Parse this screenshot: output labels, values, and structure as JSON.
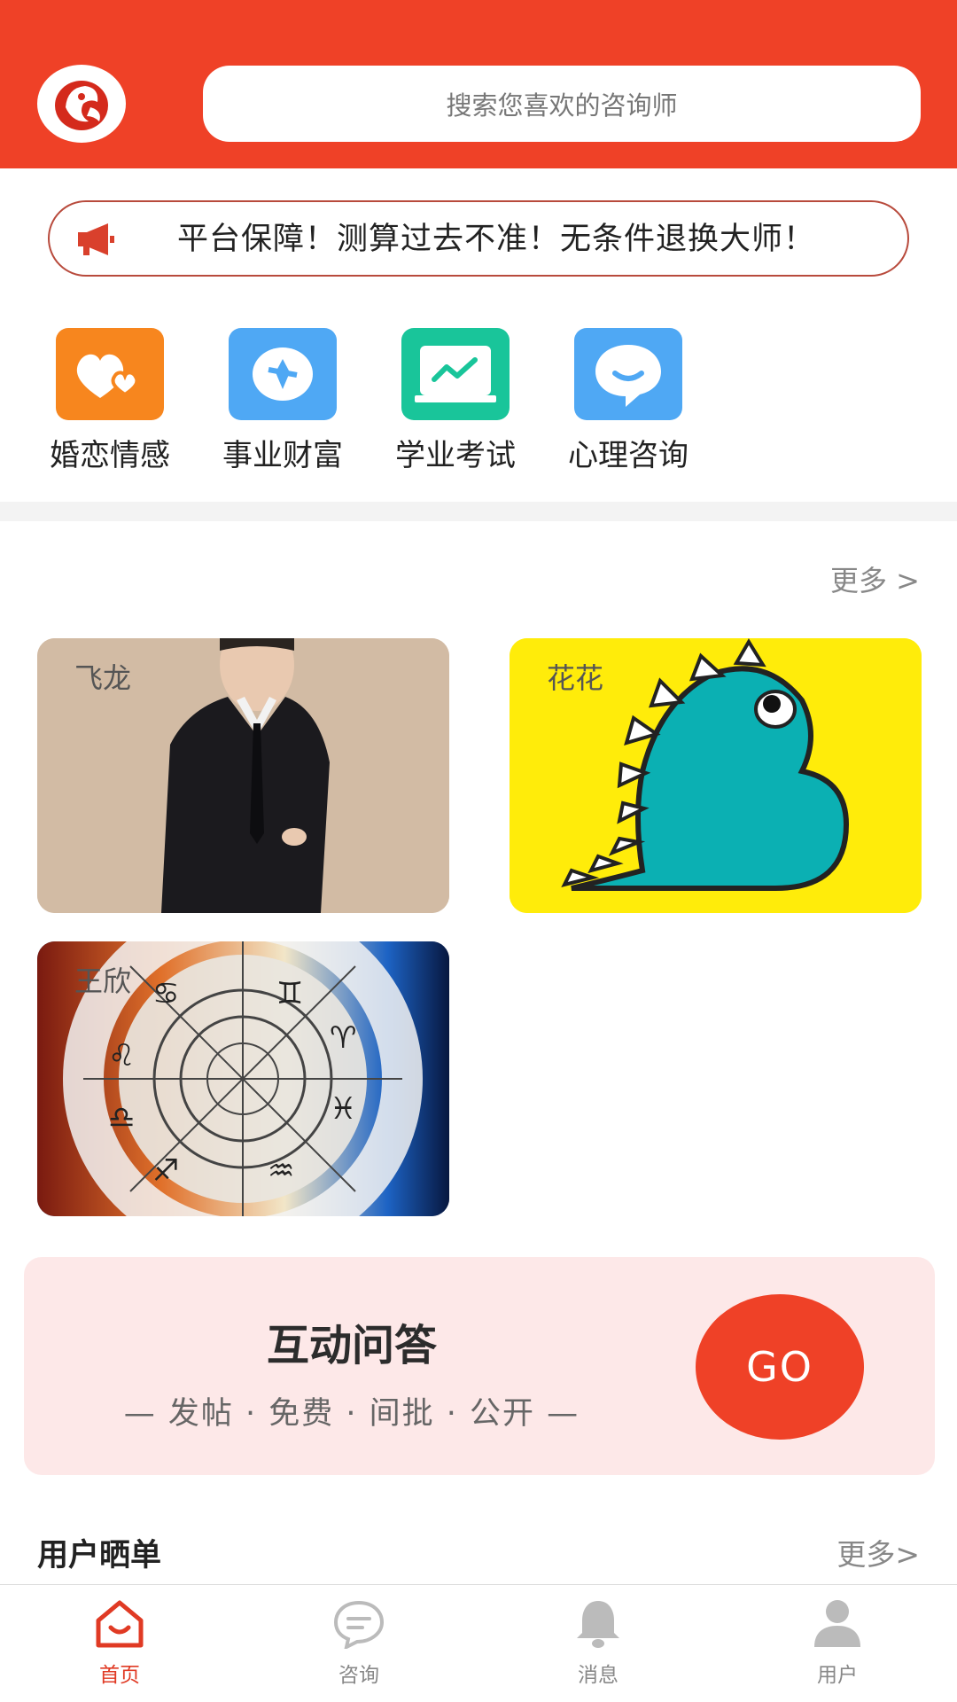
{
  "header": {
    "search_placeholder": "搜索您喜欢的咨询师",
    "brand_color": "#ef4127"
  },
  "notice": {
    "icon": "megaphone-icon",
    "text": "平台保障！测算过去不准！无条件退换大师！"
  },
  "categories": [
    {
      "label": "婚恋情感",
      "icon": "hearts-icon",
      "color": "#f7861e"
    },
    {
      "label": "事业财富",
      "icon": "diamond-icon",
      "color": "#4fa8f4"
    },
    {
      "label": "学业考试",
      "icon": "chart-icon",
      "color": "#19c59a"
    },
    {
      "label": "心理咨询",
      "icon": "chat-bubble-icon",
      "color": "#4fa8f4"
    }
  ],
  "consultants": {
    "more_label": "更多 >",
    "items": [
      {
        "name": "飞龙"
      },
      {
        "name": "花花"
      },
      {
        "name": "王欣"
      }
    ]
  },
  "qa_banner": {
    "title": "互动问答",
    "subtitle": "— 发帖 · 免费 · 间批 · 公开 —",
    "go_label": "GO"
  },
  "reviews": {
    "title": "用户晒单",
    "more_label": "更多>"
  },
  "tabbar": {
    "tabs": [
      {
        "label": "首页",
        "icon": "home-icon",
        "active": true
      },
      {
        "label": "咨询",
        "icon": "chat-icon",
        "active": false
      },
      {
        "label": "消息",
        "icon": "bell-icon",
        "active": false
      },
      {
        "label": "用户",
        "icon": "user-icon",
        "active": false
      }
    ]
  }
}
